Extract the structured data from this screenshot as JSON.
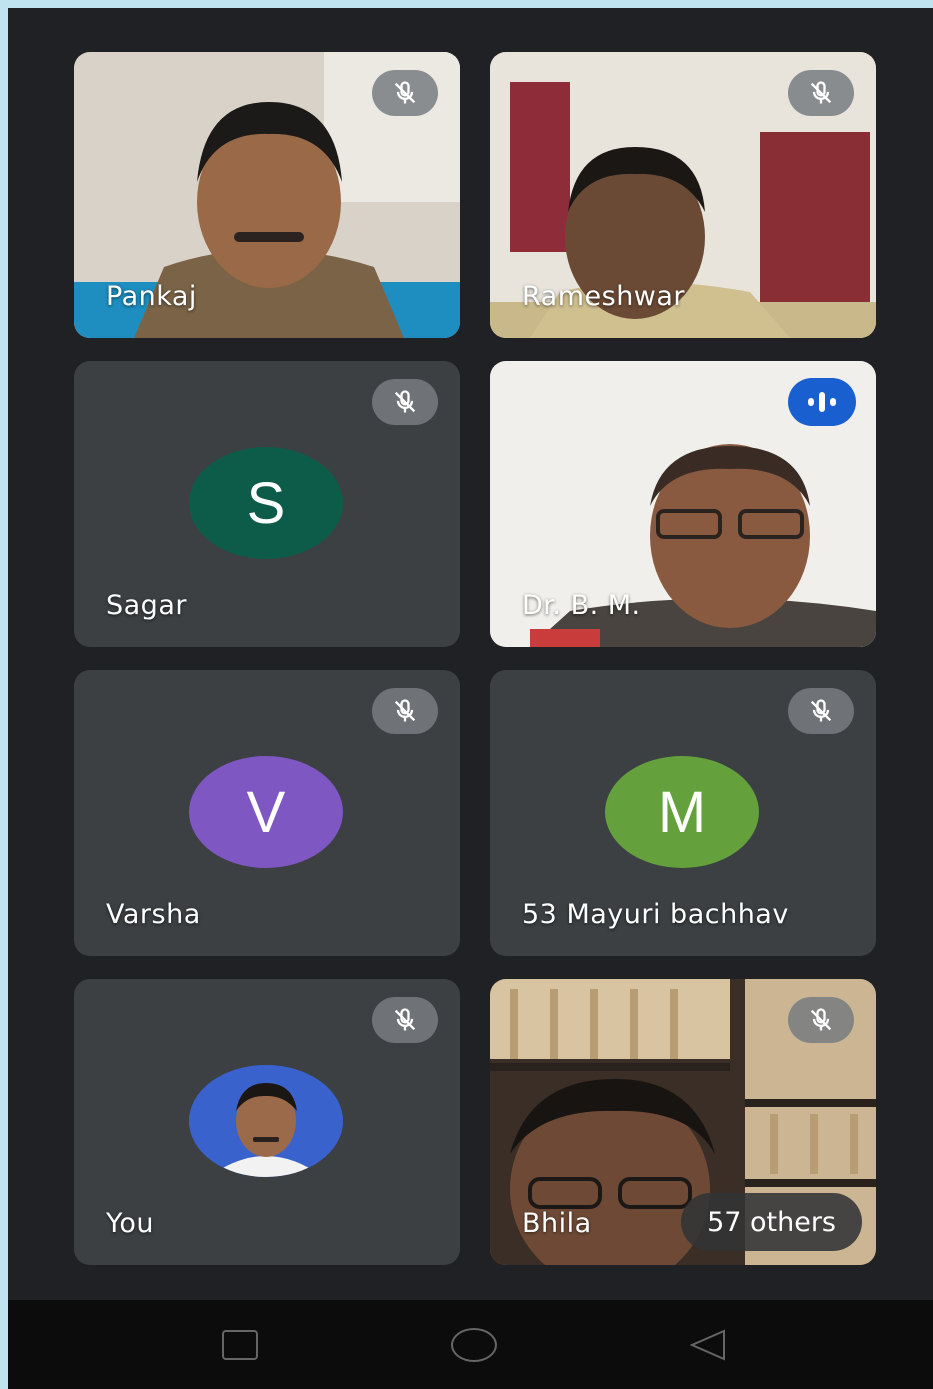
{
  "participants": [
    {
      "name": "Pankaj"
    },
    {
      "name": "Rameshwar"
    },
    {
      "name": "Sagar",
      "initial": "S"
    },
    {
      "name": "Dr. B. M."
    },
    {
      "name": "Varsha",
      "initial": "V"
    },
    {
      "name": "53 Mayuri bachhav",
      "initial": "M"
    },
    {
      "name": "You"
    },
    {
      "name": "Bhila"
    }
  ],
  "others_label": "57 others",
  "icons": {
    "muted": "mic-off-icon",
    "speaking": "speaking-indicator-icon",
    "nav_recents": "square-icon",
    "nav_home": "circle-icon",
    "nav_back": "triangle-back-icon"
  },
  "colors": {
    "background": "#202124",
    "tile": "#3c4043",
    "avatar_sagar": "#0d5c4a",
    "avatar_varsha": "#7e57c2",
    "avatar_mayuri": "#64a03c",
    "speaking": "#1a5fd0"
  }
}
